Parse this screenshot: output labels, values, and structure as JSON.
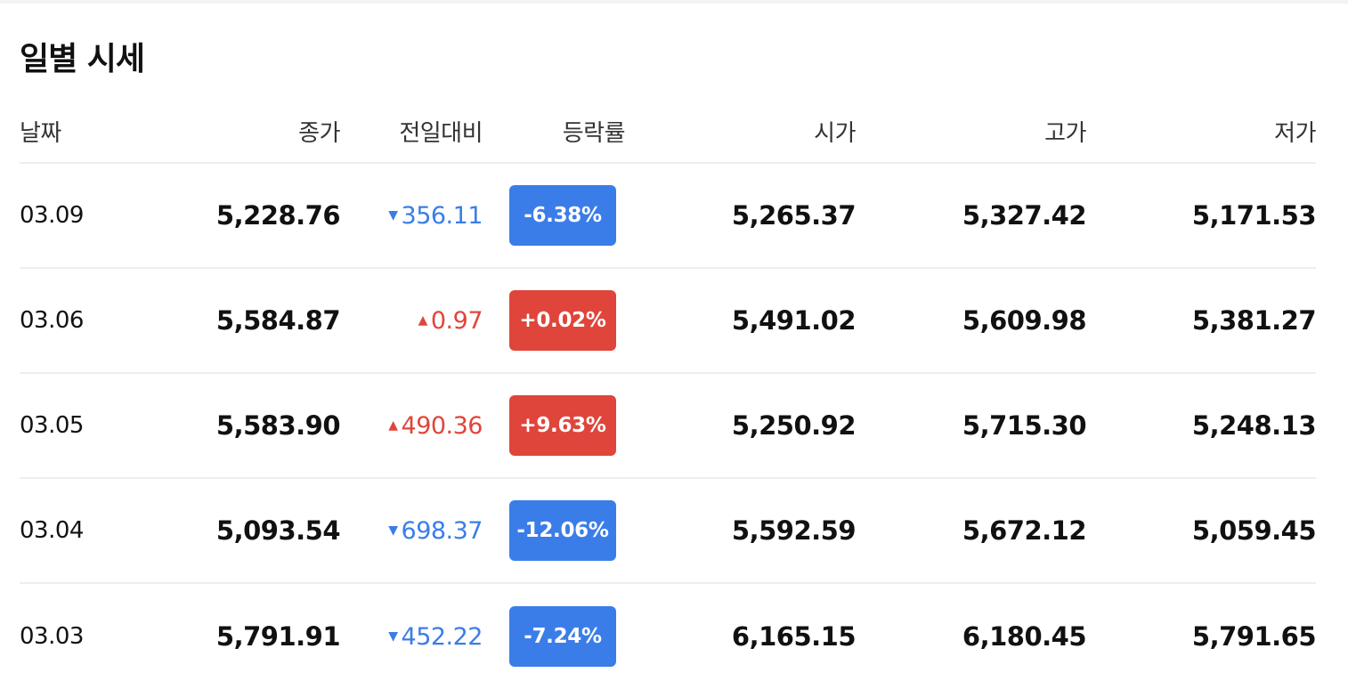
{
  "title": "일별 시세",
  "headers": {
    "date": "날짜",
    "close": "종가",
    "change": "전일대비",
    "rate": "등락률",
    "open": "시가",
    "high": "고가",
    "low": "저가"
  },
  "colors": {
    "down": "#3b7de8",
    "up": "#e0453b"
  },
  "rows": [
    {
      "date": "03.09",
      "close": "5,228.76",
      "direction": "down",
      "change": "356.11",
      "rate": "-6.38%",
      "open": "5,265.37",
      "high": "5,327.42",
      "low": "5,171.53"
    },
    {
      "date": "03.06",
      "close": "5,584.87",
      "direction": "up",
      "change": "0.97",
      "rate": "+0.02%",
      "open": "5,491.02",
      "high": "5,609.98",
      "low": "5,381.27"
    },
    {
      "date": "03.05",
      "close": "5,583.90",
      "direction": "up",
      "change": "490.36",
      "rate": "+9.63%",
      "open": "5,250.92",
      "high": "5,715.30",
      "low": "5,248.13"
    },
    {
      "date": "03.04",
      "close": "5,093.54",
      "direction": "down",
      "change": "698.37",
      "rate": "-12.06%",
      "open": "5,592.59",
      "high": "5,672.12",
      "low": "5,059.45"
    },
    {
      "date": "03.03",
      "close": "5,791.91",
      "direction": "down",
      "change": "452.22",
      "rate": "-7.24%",
      "open": "6,165.15",
      "high": "6,180.45",
      "low": "5,791.65"
    }
  ]
}
